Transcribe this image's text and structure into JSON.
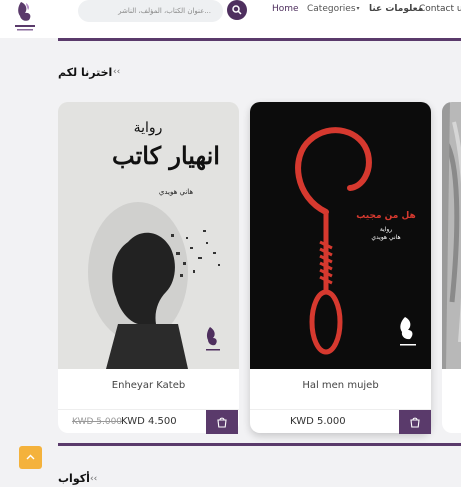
{
  "header": {
    "search": {
      "placeholder": "عنوان الكتاب، المؤلف، الناشر..."
    },
    "nav": [
      {
        "label": "Home"
      },
      {
        "label": "Categories"
      },
      {
        "label": "معلومات عنا"
      },
      {
        "label": "Contact u"
      }
    ]
  },
  "sections": [
    {
      "title": "اخترنا لكم"
    },
    {
      "title": "أكواب"
    }
  ],
  "products": [
    {
      "title": "Enheyar Kateb",
      "price_old": "KWD 5.000",
      "price": "KWD 4.500",
      "cover_text": {
        "series": "رواية",
        "title": "انهيار كاتب",
        "author": "هاني هويدي"
      }
    },
    {
      "title": "Hal men mujeb",
      "price": "KWD 5.000",
      "cover_text": {
        "title": "هل من مجيب",
        "series": "رواية",
        "author": "هاني هويدي"
      }
    }
  ],
  "colors": {
    "brand": "#5a3a6b",
    "back_to_top": "#f4b23c",
    "cover_accent": "#d6392f"
  },
  "icons": [
    "logo-icon",
    "search-icon",
    "chevron-left-icon",
    "cart-icon",
    "arrow-up-icon"
  ]
}
